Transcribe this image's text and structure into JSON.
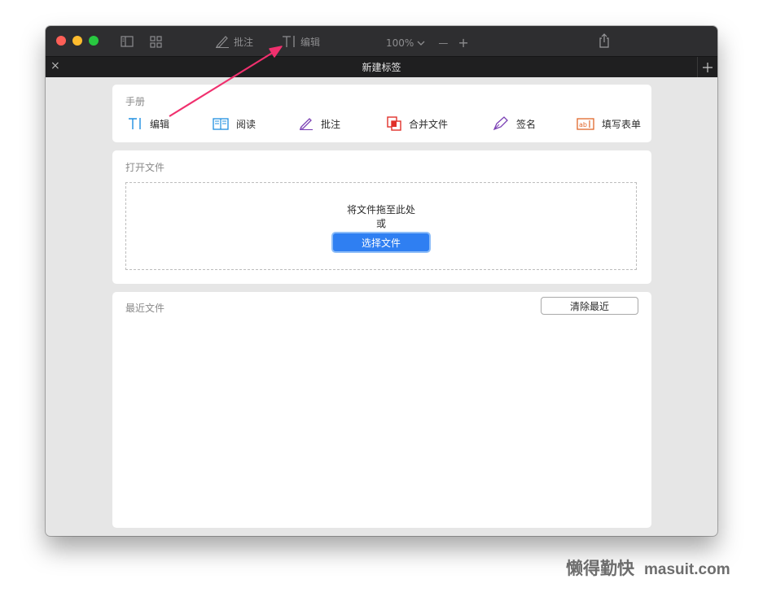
{
  "toolbar": {
    "annotate_label": "批注",
    "edit_label": "编辑",
    "zoom_value": "100%",
    "zoom_out": "—",
    "zoom_in": "+"
  },
  "tabbar": {
    "title": "新建标签",
    "close": "×",
    "add": "+"
  },
  "manual": {
    "title": "手册",
    "items": [
      {
        "label": "编辑",
        "icon": "text-cursor-icon",
        "color": "#1f8fe0"
      },
      {
        "label": "阅读",
        "icon": "book-icon",
        "color": "#1f8fe0"
      },
      {
        "label": "批注",
        "icon": "pen-icon",
        "color": "#7a3fb4"
      },
      {
        "label": "合并文件",
        "icon": "merge-icon",
        "color": "#e0302a"
      },
      {
        "label": "签名",
        "icon": "signature-pen-icon",
        "color": "#7a3fb4"
      },
      {
        "label": "填写表单",
        "icon": "form-field-icon",
        "color": "#e0662a"
      }
    ]
  },
  "open_file": {
    "title": "打开文件",
    "drop_text": "将文件拖至此处",
    "or_text": "或",
    "choose_button": "选择文件"
  },
  "recent": {
    "title": "最近文件",
    "clear_button": "清除最近"
  },
  "watermark": {
    "cn": "懒得勤快",
    "en": "masuit.com"
  },
  "colors": {
    "accent": "#2f7ff2",
    "arrow": "#f0306e",
    "titlebar": "#2e2e30"
  }
}
